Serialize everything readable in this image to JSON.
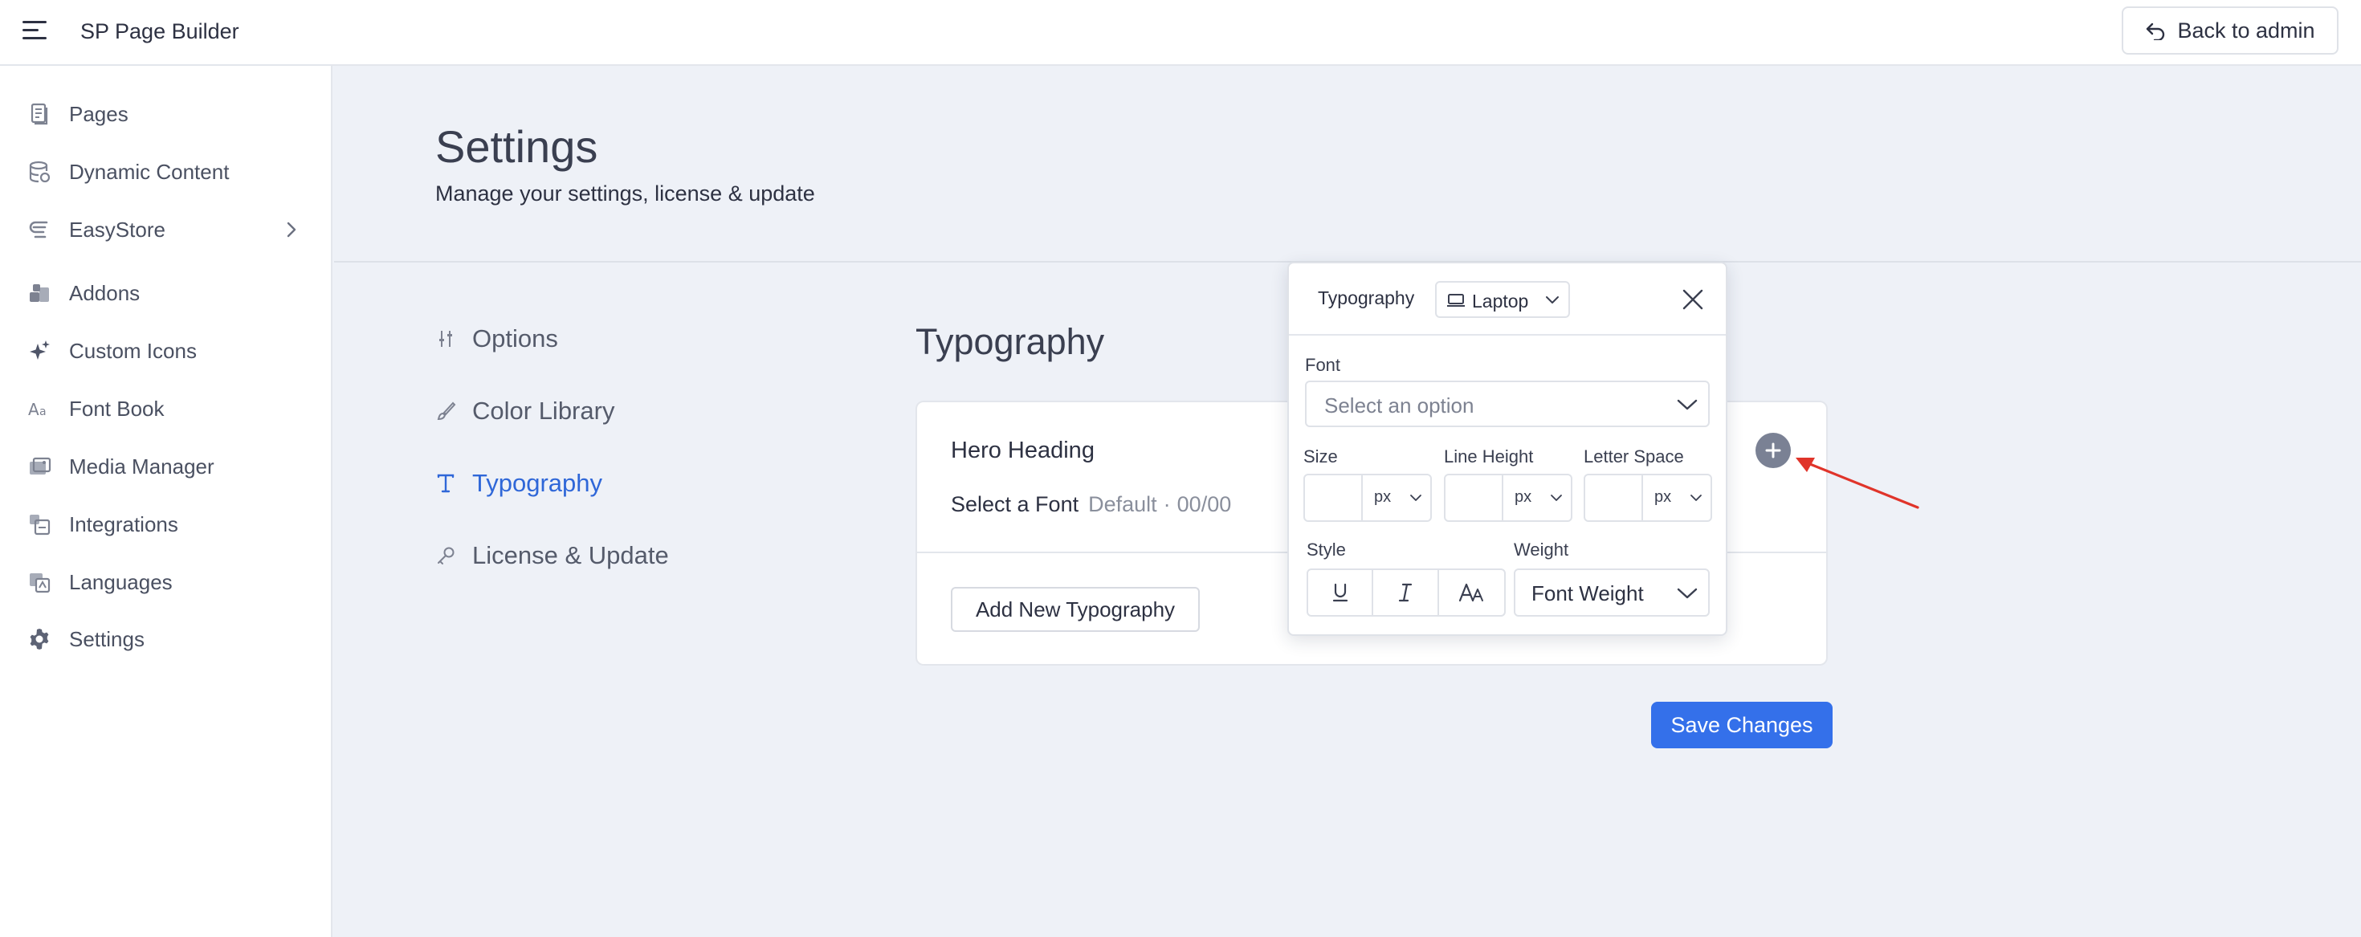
{
  "app": {
    "brand": "SP Page Builder",
    "back_button": "Back to admin"
  },
  "sidebar": {
    "items": [
      {
        "label": "Pages",
        "icon": "pages-icon"
      },
      {
        "label": "Dynamic Content",
        "icon": "database-icon"
      },
      {
        "label": "EasyStore",
        "icon": "easystore-icon",
        "has_submenu": true
      },
      {
        "label": "Addons",
        "icon": "addons-icon"
      },
      {
        "label": "Custom Icons",
        "icon": "sparkle-icon"
      },
      {
        "label": "Font Book",
        "icon": "font-icon"
      },
      {
        "label": "Media Manager",
        "icon": "media-icon"
      },
      {
        "label": "Integrations",
        "icon": "integrations-icon"
      },
      {
        "label": "Languages",
        "icon": "languages-icon"
      },
      {
        "label": "Settings",
        "icon": "gear-icon"
      }
    ]
  },
  "page": {
    "title": "Settings",
    "subtitle": "Manage your settings, license & update"
  },
  "settings_nav": {
    "items": [
      {
        "label": "Options",
        "icon": "sliders-icon",
        "active": false
      },
      {
        "label": "Color Library",
        "icon": "brush-icon",
        "active": false
      },
      {
        "label": "Typography",
        "icon": "typography-icon",
        "active": true
      },
      {
        "label": "License & Update",
        "icon": "key-icon",
        "active": false
      }
    ]
  },
  "typography": {
    "title": "Typography",
    "entry": {
      "name": "Hero Heading",
      "font_label": "Select a Font",
      "font_default": "Default",
      "font_size_info": "00/00"
    },
    "add_button": "Add New Typography",
    "save_button": "Save Changes"
  },
  "popover": {
    "title": "Typography",
    "device": "Laptop",
    "font_label": "Font",
    "font_placeholder": "Select an option",
    "size_label": "Size",
    "line_height_label": "Line Height",
    "letter_space_label": "Letter Space",
    "size_unit": "px",
    "line_height_unit": "px",
    "letter_space_unit": "px",
    "style_label": "Style",
    "weight_label": "Weight",
    "weight_placeholder": "Font Weight"
  },
  "colors": {
    "accent": "#3470ea",
    "active_nav": "#2f67d8",
    "annotation_arrow": "#e0342a"
  }
}
